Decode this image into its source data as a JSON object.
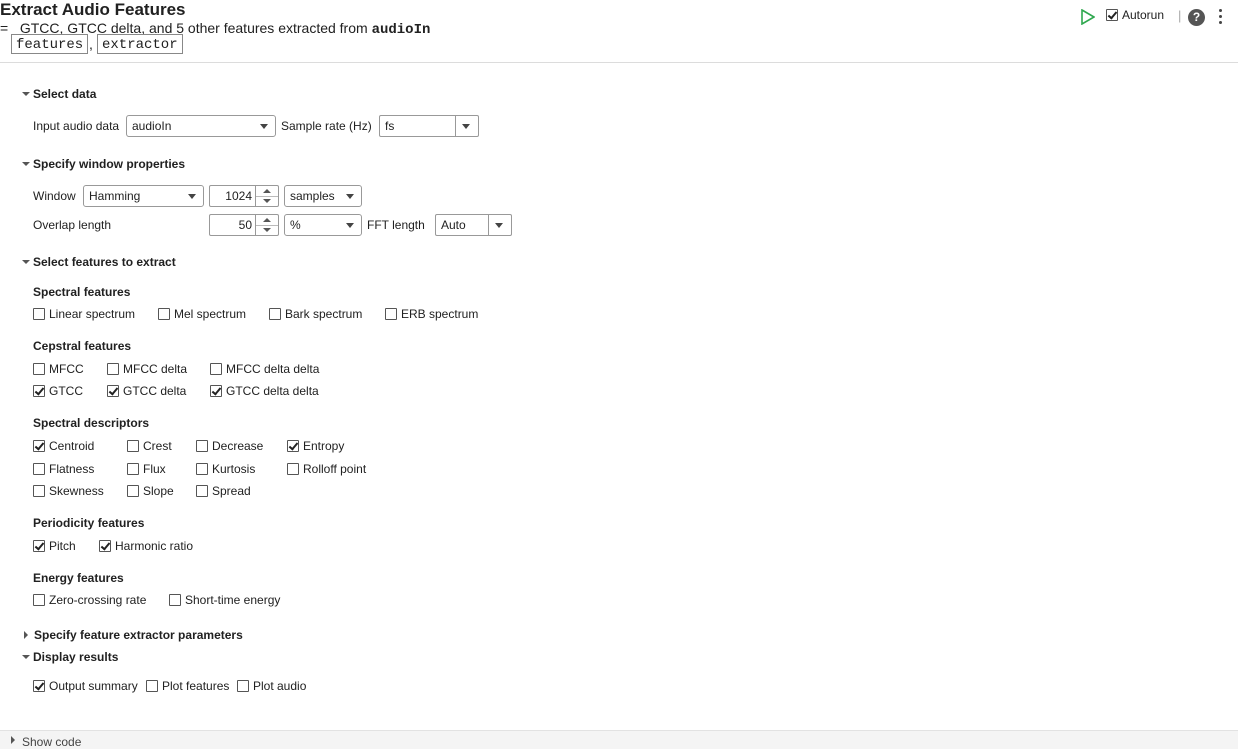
{
  "header": {
    "title": "Extract Audio Features",
    "outputs": [
      "features",
      "extractor"
    ],
    "comma": ",",
    "equals": "=",
    "summary_text": "GTCC, GTCC delta, and 5 other features extracted from",
    "summary_var": "audioIn",
    "autorun_label": "Autorun",
    "autorun_checked": true,
    "separator": "|",
    "help_glyph": "?"
  },
  "select_data": {
    "heading": "Select data",
    "input_label": "Input audio data",
    "input_value": "audioIn",
    "rate_label": "Sample rate (Hz)",
    "rate_value": "fs"
  },
  "window_props": {
    "heading": "Specify window properties",
    "window_label": "Window",
    "window_value": "Hamming",
    "window_length": "1024",
    "window_unit": "samples",
    "overlap_label": "Overlap length",
    "overlap_value": "50",
    "overlap_unit": "%",
    "fft_label": "FFT length",
    "fft_value": "Auto"
  },
  "features": {
    "heading": "Select features to extract",
    "spectral": {
      "title": "Spectral features",
      "items": [
        {
          "label": "Linear spectrum",
          "checked": false
        },
        {
          "label": "Mel spectrum",
          "checked": false
        },
        {
          "label": "Bark spectrum",
          "checked": false
        },
        {
          "label": "ERB spectrum",
          "checked": false
        }
      ]
    },
    "cepstral": {
      "title": "Cepstral features",
      "items": [
        {
          "label": "MFCC",
          "checked": false
        },
        {
          "label": "MFCC delta",
          "checked": false
        },
        {
          "label": "MFCC delta delta",
          "checked": false
        },
        {
          "label": "GTCC",
          "checked": true
        },
        {
          "label": "GTCC delta",
          "checked": true
        },
        {
          "label": "GTCC delta delta",
          "checked": true
        }
      ]
    },
    "descriptors": {
      "title": "Spectral descriptors",
      "items": [
        {
          "label": "Centroid",
          "checked": true
        },
        {
          "label": "Crest",
          "checked": false
        },
        {
          "label": "Decrease",
          "checked": false
        },
        {
          "label": "Entropy",
          "checked": true
        },
        {
          "label": "Flatness",
          "checked": false
        },
        {
          "label": "Flux",
          "checked": false
        },
        {
          "label": "Kurtosis",
          "checked": false
        },
        {
          "label": "Rolloff point",
          "checked": false
        },
        {
          "label": "Skewness",
          "checked": false
        },
        {
          "label": "Slope",
          "checked": false
        },
        {
          "label": "Spread",
          "checked": false
        }
      ]
    },
    "periodicity": {
      "title": "Periodicity features",
      "items": [
        {
          "label": "Pitch",
          "checked": true
        },
        {
          "label": "Harmonic ratio",
          "checked": true
        }
      ]
    },
    "energy": {
      "title": "Energy features",
      "items": [
        {
          "label": "Zero-crossing rate",
          "checked": false
        },
        {
          "label": "Short-time energy",
          "checked": false
        }
      ]
    }
  },
  "extractor_params": {
    "heading": "Specify feature extractor parameters"
  },
  "display": {
    "heading": "Display results",
    "items": [
      {
        "label": "Output summary",
        "checked": true
      },
      {
        "label": "Plot features",
        "checked": false
      },
      {
        "label": "Plot audio",
        "checked": false
      }
    ]
  },
  "footer": {
    "show_code": "Show code"
  },
  "colors": {
    "run_icon": "#2fa84f",
    "accent": "#212121"
  }
}
